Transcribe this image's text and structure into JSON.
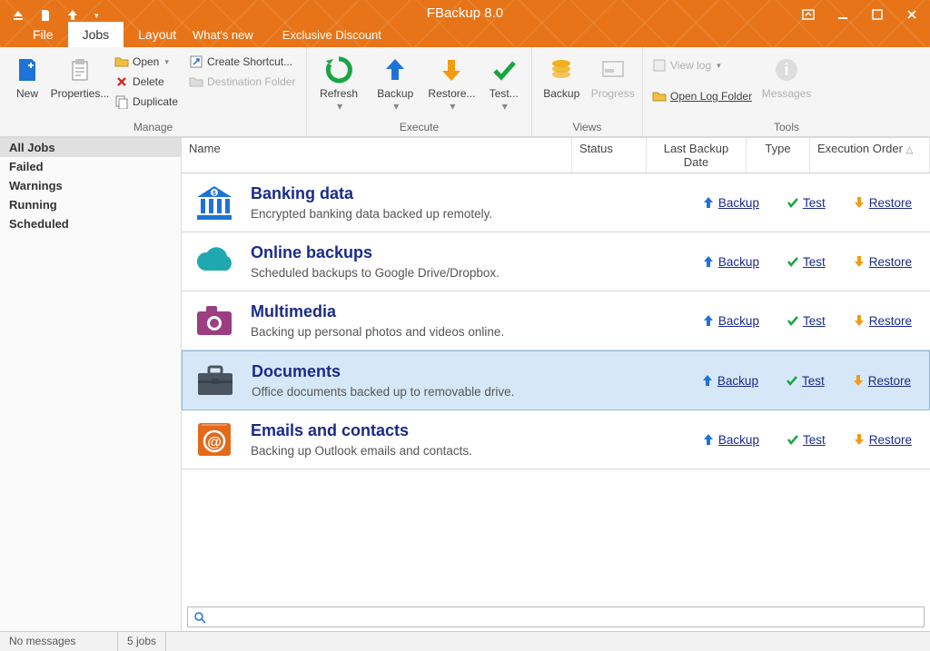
{
  "app_title": "FBackup 8.0",
  "qat_icons": [
    "eject-icon",
    "page-icon",
    "upload-icon"
  ],
  "tabs": {
    "file": "File",
    "jobs": "Jobs",
    "layout": "Layout"
  },
  "promos": {
    "whats_new": "What's new",
    "discount": "Exclusive Discount"
  },
  "ribbon": {
    "manage": {
      "label": "Manage",
      "new": "New",
      "properties": "Properties...",
      "open": "Open",
      "delete": "Delete",
      "duplicate": "Duplicate",
      "create_shortcut": "Create Shortcut...",
      "destination_folder": "Destination Folder"
    },
    "execute": {
      "label": "Execute",
      "refresh": "Refresh",
      "backup": "Backup",
      "restore": "Restore...",
      "test": "Test..."
    },
    "views": {
      "label": "Views",
      "backup": "Backup",
      "progress": "Progress"
    },
    "tools": {
      "label": "Tools",
      "view_log": "View log",
      "open_log_folder": "Open Log Folder",
      "messages": "Messages"
    }
  },
  "sidebar": {
    "items": [
      "All Jobs",
      "Failed",
      "Warnings",
      "Running",
      "Scheduled"
    ]
  },
  "columns": {
    "name": "Name",
    "status": "Status",
    "last_backup": "Last Backup Date",
    "type": "Type",
    "exec_order": "Execution Order"
  },
  "action_labels": {
    "backup": "Backup",
    "test": "Test",
    "restore": "Restore"
  },
  "jobs": [
    {
      "title": "Banking data",
      "desc": "Encrypted banking data backed up remotely.",
      "icon": "bank",
      "selected": false
    },
    {
      "title": "Online backups",
      "desc": "Scheduled backups to Google Drive/Dropbox.",
      "icon": "cloud",
      "selected": false
    },
    {
      "title": "Multimedia",
      "desc": "Backing up personal photos and videos online.",
      "icon": "camera",
      "selected": false
    },
    {
      "title": "Documents",
      "desc": "Office documents backed up to removable drive.",
      "icon": "briefcase",
      "selected": true
    },
    {
      "title": "Emails and contacts",
      "desc": "Backing up Outlook emails and contacts.",
      "icon": "email",
      "selected": false
    }
  ],
  "status": {
    "messages": "No messages",
    "jobs": "5 jobs"
  },
  "colors": {
    "accent_orange": "#e77418",
    "link_blue": "#1a2b8a",
    "arrow_blue": "#1e73d6",
    "arrow_orange": "#f39c12",
    "check_green": "#1aa544",
    "teal": "#1fa8b0",
    "purple": "#9b3e83"
  }
}
